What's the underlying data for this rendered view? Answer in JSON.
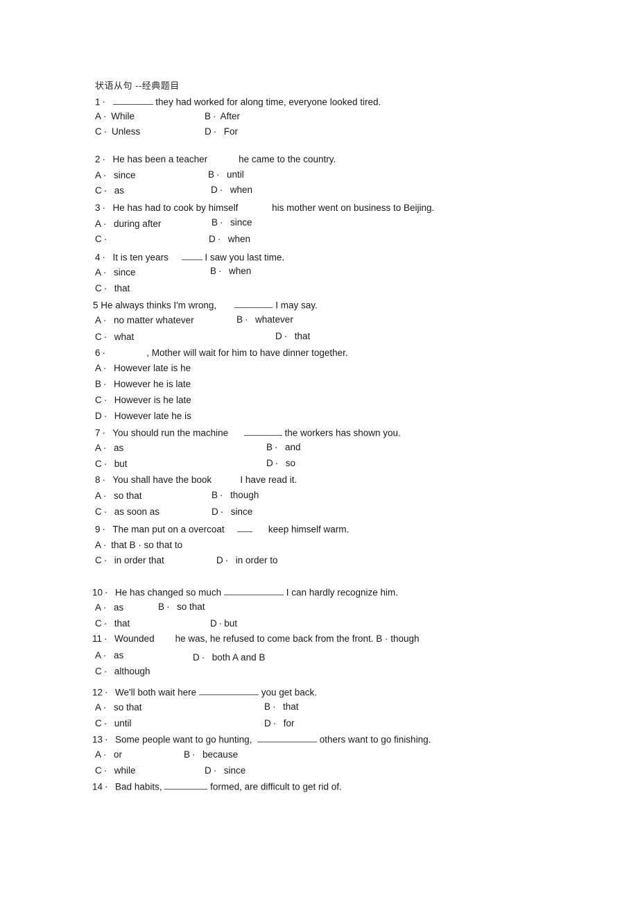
{
  "document": {
    "title": "状语从句 --经典题目",
    "separator": "·",
    "questions": [
      {
        "number": "1",
        "text_before": "",
        "text_after": "they had worked for along time, everyone looked tired.",
        "options": [
          {
            "letter": "A",
            "text": "While"
          },
          {
            "letter": "B",
            "text": "After"
          },
          {
            "letter": "C",
            "text": "Unless"
          },
          {
            "letter": "D",
            "text": "For"
          }
        ]
      },
      {
        "number": "2",
        "text_before": "He has been a teacher",
        "text_after": "he came to the country.",
        "options": [
          {
            "letter": "A",
            "text": "since"
          },
          {
            "letter": "B",
            "text": "until"
          },
          {
            "letter": "C",
            "text": "as"
          },
          {
            "letter": "D",
            "text": "when"
          }
        ]
      },
      {
        "number": "3",
        "text_before": "He has had to cook by himself",
        "text_after": "his mother went on business to Beijing.",
        "options": [
          {
            "letter": "A",
            "text": "during after"
          },
          {
            "letter": "B",
            "text": "since"
          },
          {
            "letter": "C",
            "text": ""
          },
          {
            "letter": "D",
            "text": "when"
          }
        ]
      },
      {
        "number": "4",
        "text_before": "It is ten years",
        "text_after": "I saw you last time.",
        "options": [
          {
            "letter": "A",
            "text": "since"
          },
          {
            "letter": "B",
            "text": "when"
          },
          {
            "letter": "C",
            "text": "that"
          }
        ]
      },
      {
        "number": "5",
        "text_before": "He always thinks I'm wrong,",
        "text_after": "I may say.",
        "options": [
          {
            "letter": "A",
            "text": "no matter whatever"
          },
          {
            "letter": "B",
            "text": "whatever"
          },
          {
            "letter": "C",
            "text": "what"
          },
          {
            "letter": "D",
            "text": "that"
          }
        ]
      },
      {
        "number": "6",
        "text_before": "",
        "text_after": ", Mother will wait for him to have dinner together.",
        "options": [
          {
            "letter": "A",
            "text": "However late is he"
          },
          {
            "letter": "B",
            "text": "However he is late"
          },
          {
            "letter": "C",
            "text": "However is he late"
          },
          {
            "letter": "D",
            "text": "However late he is"
          }
        ]
      },
      {
        "number": "7",
        "text_before": "You should run the machine",
        "text_after": "the workers has shown you.",
        "options": [
          {
            "letter": "A",
            "text": "as"
          },
          {
            "letter": "B",
            "text": "and"
          },
          {
            "letter": "C",
            "text": "but"
          },
          {
            "letter": "D",
            "text": "so"
          }
        ]
      },
      {
        "number": "8",
        "text_before": "You shall have the book",
        "text_after": "I have read it.",
        "options": [
          {
            "letter": "A",
            "text": "so that"
          },
          {
            "letter": "B",
            "text": "though"
          },
          {
            "letter": "C",
            "text": "as soon as"
          },
          {
            "letter": "D",
            "text": "since"
          }
        ]
      },
      {
        "number": "9",
        "text_before": "The man put on a overcoat",
        "text_after": "keep himself warm.",
        "options": [
          {
            "letter": "A",
            "text": "that B · so that to"
          },
          {
            "letter": "C",
            "text": "in order that"
          },
          {
            "letter": "D",
            "text": "in order to"
          }
        ]
      },
      {
        "number": "10",
        "text_before": "He has changed so much",
        "text_after": "I can hardly recognize him.",
        "options": [
          {
            "letter": "A",
            "text": "as"
          },
          {
            "letter": "B",
            "text": "so that"
          },
          {
            "letter": "C",
            "text": "that"
          },
          {
            "letter": "D",
            "text": "but"
          }
        ]
      },
      {
        "number": "11",
        "text_before": "Wounded",
        "text_after": "he was, he refused to come back from the front. B · though",
        "options": [
          {
            "letter": "A",
            "text": "as"
          },
          {
            "letter": "D",
            "text": "both A and B"
          },
          {
            "letter": "C",
            "text": "although"
          }
        ]
      },
      {
        "number": "12",
        "text_before": "We'll both wait here",
        "text_after": "you get back.",
        "options": [
          {
            "letter": "A",
            "text": "so that"
          },
          {
            "letter": "B",
            "text": "that"
          },
          {
            "letter": "C",
            "text": "until"
          },
          {
            "letter": "D",
            "text": "for"
          }
        ]
      },
      {
        "number": "13",
        "text_before": "Some people want to go hunting,",
        "text_after": "others want to go finishing.",
        "options": [
          {
            "letter": "A",
            "text": "or"
          },
          {
            "letter": "B",
            "text": "because"
          },
          {
            "letter": "C",
            "text": "while"
          },
          {
            "letter": "D",
            "text": "since"
          }
        ]
      },
      {
        "number": "14",
        "text_before": "Bad habits,",
        "text_after": "formed, are difficult to get rid of.",
        "options": []
      }
    ]
  }
}
